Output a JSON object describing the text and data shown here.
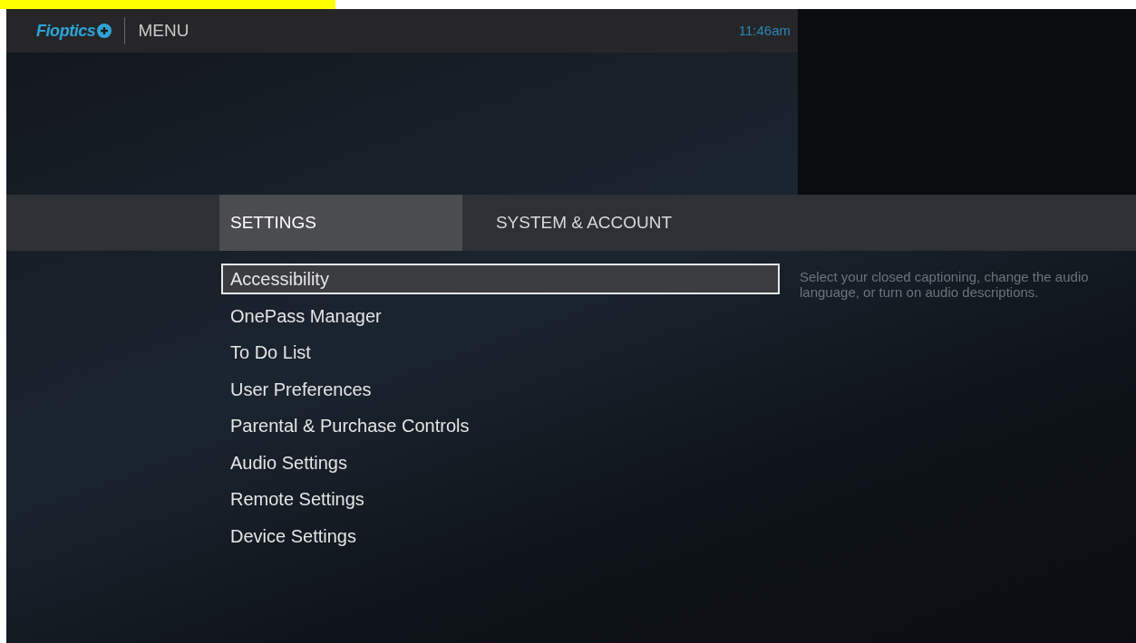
{
  "header": {
    "logo": "Fioptics",
    "title": "MENU",
    "time": "11:46am"
  },
  "tabs": [
    {
      "label": "SETTINGS",
      "selected": true
    },
    {
      "label": "SYSTEM & ACCOUNT",
      "selected": false
    }
  ],
  "menu": [
    {
      "label": "Accessibility",
      "selected": true
    },
    {
      "label": "OnePass Manager",
      "selected": false
    },
    {
      "label": "To Do List",
      "selected": false
    },
    {
      "label": "User Preferences",
      "selected": false
    },
    {
      "label": "Parental & Purchase Controls",
      "selected": false
    },
    {
      "label": "Audio Settings",
      "selected": false
    },
    {
      "label": "Remote Settings",
      "selected": false
    },
    {
      "label": "Device Settings",
      "selected": false
    }
  ],
  "description": "Select your closed captioning, change the audio language, or turn on audio descriptions."
}
